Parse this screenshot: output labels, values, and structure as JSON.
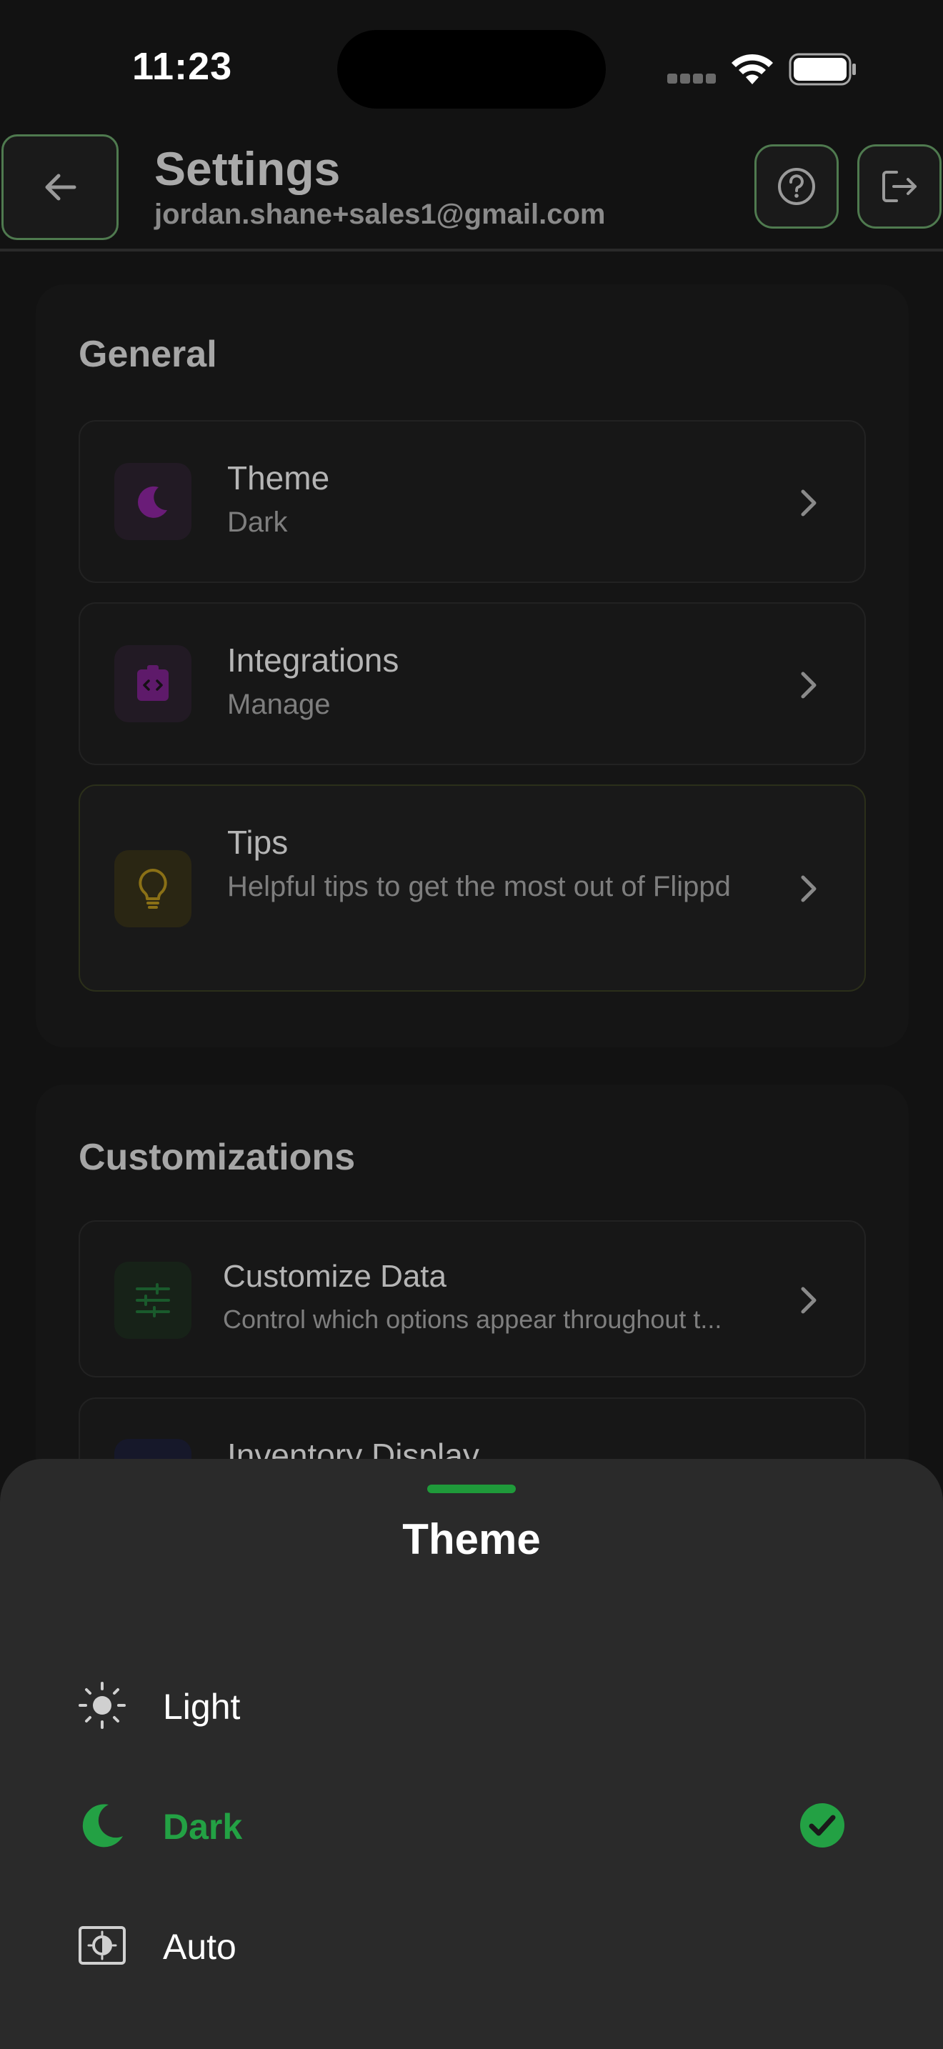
{
  "status_bar": {
    "time": "11:23"
  },
  "header": {
    "title": "Settings",
    "subtitle": "jordan.shane+sales1@gmail.com"
  },
  "general": {
    "title": "General",
    "items": [
      {
        "title": "Theme",
        "subtitle": "Dark",
        "icon": "moon-icon",
        "color": "#7a1f8a"
      },
      {
        "title": "Integrations",
        "subtitle": "Manage",
        "icon": "code-badge-icon",
        "color": "#6a1f78"
      },
      {
        "title": "Tips",
        "subtitle": "Helpful tips to get the most out of Flippd",
        "icon": "lightbulb-icon",
        "color": "#9a7a1a"
      }
    ]
  },
  "customizations": {
    "title": "Customizations",
    "items": [
      {
        "title": "Customize Data",
        "subtitle": "Control which options appear throughout t...",
        "icon": "sliders-icon",
        "color": "#1f6a35"
      },
      {
        "title": "Inventory Display",
        "icon": "display-icon"
      }
    ]
  },
  "theme_sheet": {
    "title": "Theme",
    "options": [
      {
        "label": "Light",
        "icon": "sun-icon",
        "selected": false
      },
      {
        "label": "Dark",
        "icon": "moon-icon",
        "selected": true
      },
      {
        "label": "Auto",
        "icon": "auto-brightness-icon",
        "selected": false
      }
    ],
    "accent": "#23a144"
  }
}
